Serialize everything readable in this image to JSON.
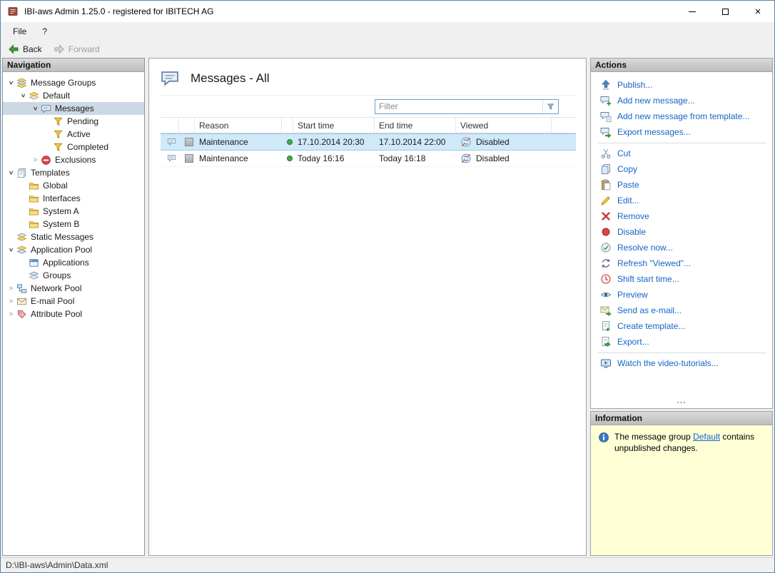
{
  "window": {
    "title": "IBI-aws Admin 1.25.0 - registered for IBITECH AG"
  },
  "menu": {
    "items": [
      {
        "label": "File"
      },
      {
        "label": "?"
      }
    ]
  },
  "toolbar": {
    "back": "Back",
    "forward": "Forward"
  },
  "navigation": {
    "header": "Navigation",
    "tree": [
      {
        "label": "Message Groups",
        "level": 0,
        "expander": "expanded",
        "icon": "message-groups-icon",
        "selected": false
      },
      {
        "label": "Default",
        "level": 1,
        "expander": "expanded",
        "icon": "message-group-icon",
        "selected": false
      },
      {
        "label": "Messages",
        "level": 2,
        "expander": "expanded",
        "icon": "messages-icon",
        "selected": true
      },
      {
        "label": "Pending",
        "level": 3,
        "expander": "none",
        "icon": "filter-funnel-icon",
        "selected": false
      },
      {
        "label": "Active",
        "level": 3,
        "expander": "none",
        "icon": "filter-funnel-icon",
        "selected": false
      },
      {
        "label": "Completed",
        "level": 3,
        "expander": "none",
        "icon": "filter-funnel-icon",
        "selected": false
      },
      {
        "label": "Exclusions",
        "level": 2,
        "expander": "collapsed",
        "icon": "exclusions-icon",
        "selected": false
      },
      {
        "label": "Templates",
        "level": 0,
        "expander": "expanded",
        "icon": "templates-icon",
        "selected": false
      },
      {
        "label": "Global",
        "level": 1,
        "expander": "none",
        "icon": "folder-icon",
        "selected": false
      },
      {
        "label": "Interfaces",
        "level": 1,
        "expander": "none",
        "icon": "folder-icon",
        "selected": false
      },
      {
        "label": "System A",
        "level": 1,
        "expander": "none",
        "icon": "folder-icon",
        "selected": false
      },
      {
        "label": "System B",
        "level": 1,
        "expander": "none",
        "icon": "folder-icon",
        "selected": false
      },
      {
        "label": "Static Messages",
        "level": 0,
        "expander": "none",
        "icon": "static-messages-icon",
        "selected": false
      },
      {
        "label": "Application Pool",
        "level": 0,
        "expander": "expanded",
        "icon": "application-pool-icon",
        "selected": false
      },
      {
        "label": "Applications",
        "level": 1,
        "expander": "none",
        "icon": "applications-icon",
        "selected": false
      },
      {
        "label": "Groups",
        "level": 1,
        "expander": "none",
        "icon": "groups-icon",
        "selected": false
      },
      {
        "label": "Network Pool",
        "level": 0,
        "expander": "collapsed",
        "icon": "network-pool-icon",
        "selected": false
      },
      {
        "label": "E-mail Pool",
        "level": 0,
        "expander": "collapsed",
        "icon": "email-pool-icon",
        "selected": false
      },
      {
        "label": "Attribute Pool",
        "level": 0,
        "expander": "collapsed",
        "icon": "attribute-pool-icon",
        "selected": false
      }
    ]
  },
  "main": {
    "title": "Messages - All",
    "filter_placeholder": "Filter",
    "table": {
      "columns": [
        "Reason",
        "Start time",
        "End time",
        "Viewed"
      ],
      "rows": [
        {
          "icon": "message-row-icon",
          "reason": "Maintenance",
          "status": "green",
          "start": "17.10.2014 20:30",
          "end": "17.10.2014 22:00",
          "viewed": "Disabled",
          "viewed_icon": "disabled-schedule-icon",
          "selected": true
        },
        {
          "icon": "message-row-icon",
          "reason": "Maintenance",
          "status": "green",
          "start": "Today 16:16",
          "end": "Today 16:18",
          "viewed": "Disabled",
          "viewed_icon": "disabled-schedule-icon",
          "selected": false
        }
      ]
    }
  },
  "actions": {
    "header": "Actions",
    "groups": [
      {
        "items": [
          {
            "label": "Publish...",
            "icon": "publish-icon"
          },
          {
            "label": "Add new message...",
            "icon": "add-message-icon"
          },
          {
            "label": "Add new message from template...",
            "icon": "add-message-template-icon"
          },
          {
            "label": "Export messages...",
            "icon": "export-messages-icon"
          }
        ]
      },
      {
        "items": [
          {
            "label": "Cut",
            "icon": "cut-icon"
          },
          {
            "label": "Copy",
            "icon": "copy-icon"
          },
          {
            "label": "Paste",
            "icon": "paste-icon"
          },
          {
            "label": "Edit...",
            "icon": "edit-icon"
          },
          {
            "label": "Remove",
            "icon": "remove-icon"
          },
          {
            "label": "Disable",
            "icon": "disable-icon"
          },
          {
            "label": "Resolve now...",
            "icon": "resolve-icon"
          },
          {
            "label": "Refresh \"Viewed\"...",
            "icon": "refresh-viewed-icon"
          },
          {
            "label": "Shift start time...",
            "icon": "shift-time-icon"
          },
          {
            "label": "Preview",
            "icon": "preview-icon"
          },
          {
            "label": "Send as e-mail...",
            "icon": "send-email-icon"
          },
          {
            "label": "Create template...",
            "icon": "create-template-icon"
          },
          {
            "label": "Export...",
            "icon": "export-icon"
          }
        ]
      },
      {
        "items": [
          {
            "label": "Watch the video-tutorials...",
            "icon": "video-tutorials-icon"
          }
        ]
      }
    ],
    "overflow": "..."
  },
  "information": {
    "header": "Information",
    "prefix": "The message group ",
    "link": "Default",
    "suffix": " contains unpublished changes."
  },
  "statusbar": {
    "path": "D:\\IBI-aws\\Admin\\Data.xml"
  },
  "colors": {
    "link_blue": "#1464c8",
    "selected_row_bg": "#cfe9f9",
    "info_bg": "#ffffd6",
    "status_green": "#3fae49"
  }
}
